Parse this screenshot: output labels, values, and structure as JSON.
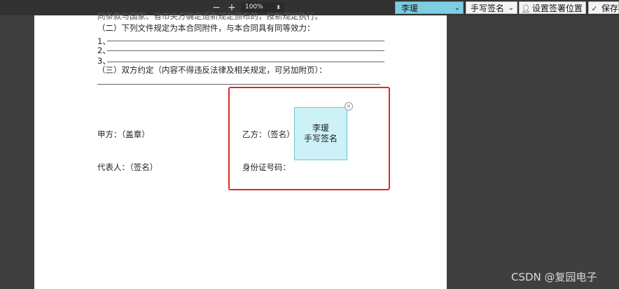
{
  "toolbar": {
    "zoom_out": "−",
    "zoom_in": "+",
    "zoom_level": "100%",
    "signer": "李瑗",
    "sign_mode": "手写签名",
    "place_button": "设置签署位置",
    "save_button": "保存"
  },
  "document": {
    "cutoff_line": "同条款与国家、省市关方确定适新规定颁布的，按新规定执行。",
    "clause_2": "（二）下列文件规定为本合同附件，与本合同具有同等效力：",
    "attach_1": "1、",
    "attach_2": "2、",
    "attach_3": "3、",
    "clause_3": "（三）双方约定（内容不得违反法律及相关规定，可另加附页）：",
    "party_a": "甲方：（盖章）",
    "party_b": "乙方：（签名）",
    "representative": "代表人：（签名）",
    "id_number": "身份证号码："
  },
  "stamp": {
    "name": "李瑗",
    "type": "手写签名",
    "close": "×"
  },
  "watermark": "CSDN @复园电子"
}
